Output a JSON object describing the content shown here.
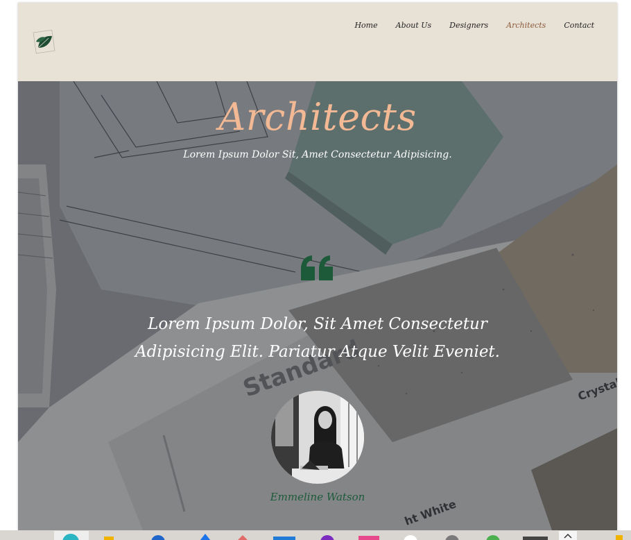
{
  "nav": {
    "items": [
      {
        "label": "Home"
      },
      {
        "label": "About Us"
      },
      {
        "label": "Designers"
      },
      {
        "label": "Architects",
        "active": true
      },
      {
        "label": "Contact"
      }
    ]
  },
  "hero": {
    "title": "Architects",
    "subtitle": "Lorem Ipsum Dolor Sit, Amet Consectetur Adipisicing.",
    "quote_line1": "Lorem Ipsum Dolor, Sit Amet Consectetur",
    "quote_line2": "Adipisicing Elit. Pariatur Atque Velit Eveniet.",
    "person_name": "Emmeline Watson"
  },
  "icons": {
    "logo": "leaf-logo-icon",
    "quote": "quote-icon"
  },
  "colors": {
    "header_bg": "#e8e1d6",
    "title": "#f3b894",
    "accent_green": "#1d5a3a",
    "nav_active": "#8a5a3a"
  }
}
